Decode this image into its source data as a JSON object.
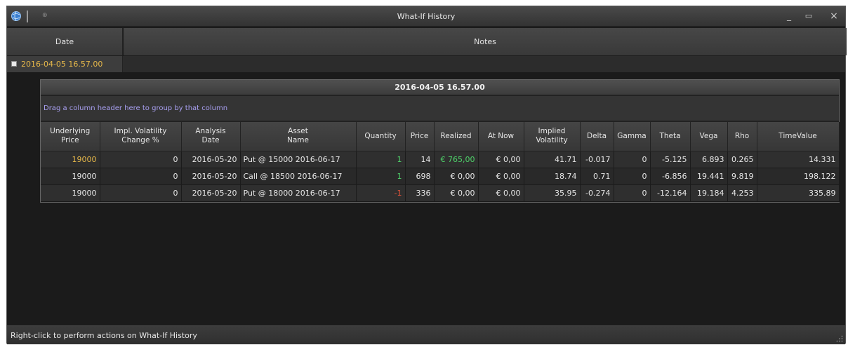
{
  "window": {
    "title": "What-If History",
    "minimize_glyph": "_",
    "maximize_glyph": "▭",
    "close_glyph": "×",
    "pin_glyph": "⊕"
  },
  "header": {
    "date_label": "Date",
    "notes_label": "Notes"
  },
  "group": {
    "date": "2016-04-05 16.57.00"
  },
  "detail": {
    "title": "2016-04-05 16.57.00",
    "group_hint": "Drag a column header here to group by that column",
    "columns": [
      "Underlying\nPrice",
      "Impl. Volatility\nChange %",
      "Analysis\nDate",
      "Asset\nName",
      "Quantity",
      "Price",
      "Realized",
      "At Now",
      "Implied\nVolatility",
      "Delta",
      "Gamma",
      "Theta",
      "Vega",
      "Rho",
      "TimeValue"
    ],
    "rows": [
      [
        "19000",
        "0",
        "2016-05-20",
        "Put @ 15000 2016-06-17",
        "1",
        "14",
        "€ 765,00",
        "€ 0,00",
        "41.71",
        "-0.017",
        "0",
        "-5.125",
        "6.893",
        "0.265",
        "14.331"
      ],
      [
        "19000",
        "0",
        "2016-05-20",
        "Call @ 18500 2016-06-17",
        "1",
        "698",
        "€ 0,00",
        "€ 0,00",
        "18.74",
        "0.71",
        "0",
        "-6.856",
        "19.441",
        "9.819",
        "198.122"
      ],
      [
        "19000",
        "0",
        "2016-05-20",
        "Put @ 18000 2016-06-17",
        "-1",
        "336",
        "€ 0,00",
        "€ 0,00",
        "35.95",
        "-0.274",
        "0",
        "-12.164",
        "19.184",
        "4.253",
        "335.89"
      ]
    ]
  },
  "status": {
    "text": "Right-click to perform actions on What-If History"
  },
  "colors": {
    "accent_gold": "#e6b84a",
    "positive_green": "#4fd36a",
    "negative_red": "#e0533a",
    "hint_purple": "#a9a0f2"
  }
}
